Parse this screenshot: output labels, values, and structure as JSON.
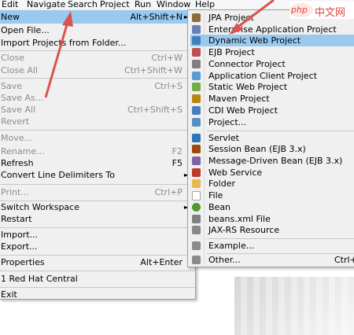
{
  "menubar": {
    "items": [
      "Edit",
      "Navigate",
      "Search",
      "Project",
      "Run",
      "Window",
      "Help"
    ]
  },
  "file_menu": {
    "items": [
      {
        "label": "New",
        "shortcut": "Alt+Shift+N",
        "submenu": true,
        "highlighted": true
      },
      {
        "label": "Open File...",
        "shortcut": ""
      },
      {
        "label": "Import Projects from Folder...",
        "shortcut": ""
      },
      {
        "label": "Close",
        "shortcut": "Ctrl+W",
        "disabled": true
      },
      {
        "label": "Close All",
        "shortcut": "Ctrl+Shift+W",
        "disabled": true
      },
      {
        "label": "Save",
        "shortcut": "Ctrl+S",
        "disabled": true
      },
      {
        "label": "Save As...",
        "shortcut": "",
        "disabled": true
      },
      {
        "label": "Save All",
        "shortcut": "Ctrl+Shift+S",
        "disabled": true
      },
      {
        "label": "Revert",
        "shortcut": "",
        "disabled": true
      },
      {
        "label": "Move...",
        "shortcut": "",
        "disabled": true
      },
      {
        "label": "Rename...",
        "shortcut": "F2",
        "disabled": true
      },
      {
        "label": "Refresh",
        "shortcut": "F5"
      },
      {
        "label": "Convert Line Delimiters To",
        "shortcut": "",
        "submenu": true
      },
      {
        "label": "Print...",
        "shortcut": "Ctrl+P",
        "disabled": true
      },
      {
        "label": "Switch Workspace",
        "shortcut": "",
        "submenu": true
      },
      {
        "label": "Restart",
        "shortcut": ""
      },
      {
        "label": "Import...",
        "shortcut": ""
      },
      {
        "label": "Export...",
        "shortcut": ""
      },
      {
        "label": "Properties",
        "shortcut": "Alt+Enter"
      },
      {
        "label": "1 Red Hat Central",
        "shortcut": ""
      },
      {
        "label": "Exit",
        "shortcut": ""
      }
    ]
  },
  "new_submenu": {
    "items": [
      {
        "label": "JPA Project",
        "icon": "jpa-project-icon",
        "color": "#8a6d3b"
      },
      {
        "label": "Enterprise Application Project",
        "icon": "ear-project-icon",
        "color": "#6b7fb0"
      },
      {
        "label": "Dynamic Web Project",
        "icon": "web-project-icon",
        "color": "#3f7fbf",
        "highlighted": true
      },
      {
        "label": "EJB Project",
        "icon": "ejb-project-icon",
        "color": "#c0504d"
      },
      {
        "label": "Connector Project",
        "icon": "connector-project-icon",
        "color": "#7f7f7f"
      },
      {
        "label": "Application Client Project",
        "icon": "app-client-project-icon",
        "color": "#5b9bd5"
      },
      {
        "label": "Static Web Project",
        "icon": "static-web-project-icon",
        "color": "#70ad47"
      },
      {
        "label": "Maven Project",
        "icon": "maven-project-icon",
        "color": "#b8860b"
      },
      {
        "label": "CDI Web Project",
        "icon": "cdi-project-icon",
        "color": "#4a7ebb"
      },
      {
        "label": "Project...",
        "icon": "project-icon",
        "color": "#5a8fc2"
      },
      {
        "label": "Servlet",
        "icon": "servlet-icon",
        "color": "#2e75b6"
      },
      {
        "label": "Session Bean (EJB 3.x)",
        "icon": "session-bean-icon",
        "color": "#9e480e"
      },
      {
        "label": "Message-Driven Bean (EJB 3.x)",
        "icon": "mdb-icon",
        "color": "#8064a2"
      },
      {
        "label": "Web Service",
        "icon": "web-service-icon",
        "color": "#c0392b"
      },
      {
        "label": "Folder",
        "icon": "folder-icon",
        "color": "#e6b84d"
      },
      {
        "label": "File",
        "icon": "file-icon",
        "color": "#d9d9d9"
      },
      {
        "label": "Bean",
        "icon": "bean-icon",
        "color": "#4c9a2a"
      },
      {
        "label": "beans.xml File",
        "icon": "beans-xml-icon",
        "color": "#7f7f7f"
      },
      {
        "label": "JAX-RS Resource",
        "icon": "jaxrs-icon",
        "color": "#888888"
      },
      {
        "label": "Example...",
        "icon": "example-icon",
        "color": "#8a8a8a"
      },
      {
        "label": "Other...",
        "icon": "other-icon",
        "color": "#8a8a8a",
        "shortcut": "Ctrl+N"
      }
    ]
  },
  "watermark": {
    "logo": "php",
    "text": "中文网"
  },
  "colors": {
    "highlight": "#99c9ef",
    "annotation_arrow": "#d9534f"
  }
}
